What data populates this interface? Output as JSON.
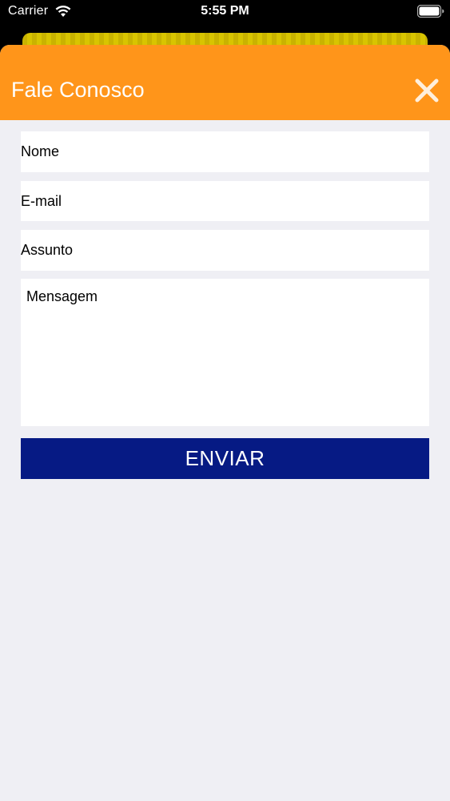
{
  "status_bar": {
    "carrier": "Carrier",
    "time": "5:55 PM",
    "wifi_icon": "wifi-icon",
    "battery_icon": "battery-icon"
  },
  "sheet": {
    "title": "Fale Conosco",
    "close_icon": "close-icon",
    "header_color": "#ff951a"
  },
  "form": {
    "name_placeholder": "Nome",
    "email_placeholder": "E-mail",
    "subject_placeholder": "Assunto",
    "message_placeholder": "Mensagem",
    "submit_label": "ENVIAR",
    "submit_color": "#061a84"
  },
  "colors": {
    "background": "#efeff4",
    "field_background": "#ffffff"
  }
}
